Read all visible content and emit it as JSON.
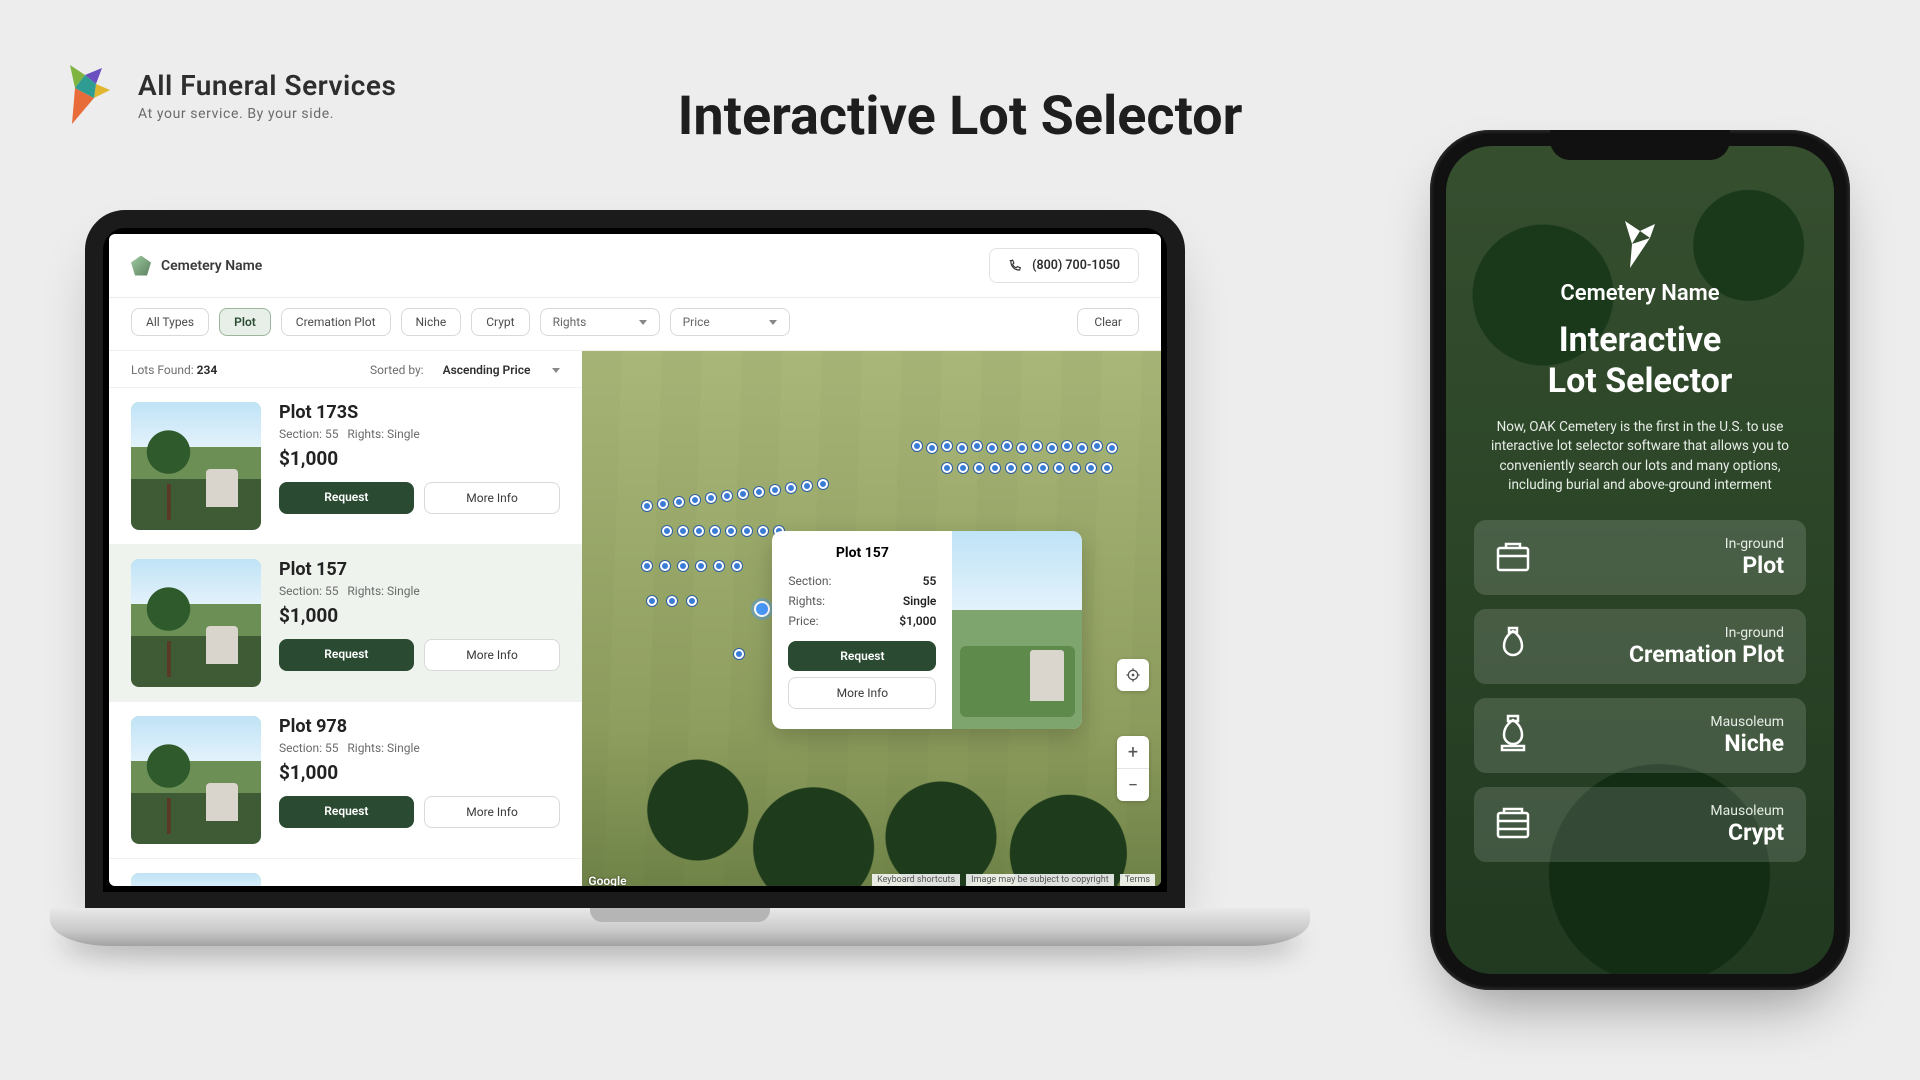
{
  "brand": {
    "title": "All Funeral Services",
    "tagline": "At your service. By your side."
  },
  "page": {
    "heading": "Interactive Lot Selector"
  },
  "app": {
    "site_name": "Cemetery Name",
    "phone": "(800) 700-1050",
    "filters": {
      "types": [
        "All Types",
        "Plot",
        "Cremation Plot",
        "Niche",
        "Crypt"
      ],
      "active_type_index": 1,
      "rights_label": "Rights",
      "price_label": "Price",
      "clear_label": "Clear"
    },
    "list": {
      "found_label": "Lots Found:",
      "found_count": "234",
      "sort_label": "Sorted by:",
      "sort_value": "Ascending Price",
      "section_label": "Section:",
      "rights_label": "Rights:",
      "request_label": "Request",
      "more_info_label": "More Info",
      "items": [
        {
          "title": "Plot 173S",
          "section": "55",
          "rights": "Single",
          "price": "$1,000"
        },
        {
          "title": "Plot 157",
          "section": "55",
          "rights": "Single",
          "price": "$1,000"
        },
        {
          "title": "Plot 978",
          "section": "55",
          "rights": "Single",
          "price": "$1,000"
        }
      ],
      "selected_index": 1
    },
    "popup": {
      "title": "Plot 157",
      "section_label": "Section:",
      "section": "55",
      "rights_label": "Rights:",
      "rights": "Single",
      "price_label": "Price:",
      "price": "$1,000",
      "request_label": "Request",
      "more_info_label": "More Info"
    },
    "map_footer": {
      "google": "Google",
      "shortcuts": "Keyboard shortcuts",
      "imagery": "Image may be subject to copyright",
      "terms": "Terms"
    }
  },
  "mobile": {
    "site_name": "Cemetery Name",
    "heading_line1": "Interactive",
    "heading_line2": "Lot Selector",
    "description": "Now, OAK Cemetery is the first in the U.S. to use interactive lot selector software that allows you to conveniently search our lots and many options, including burial and above-ground interment",
    "cards": [
      {
        "sub": "In-ground",
        "title": "Plot"
      },
      {
        "sub": "In-ground",
        "title": "Cremation Plot"
      },
      {
        "sub": "Mausoleum",
        "title": "Niche"
      },
      {
        "sub": "Mausoleum",
        "title": "Crypt"
      }
    ]
  }
}
